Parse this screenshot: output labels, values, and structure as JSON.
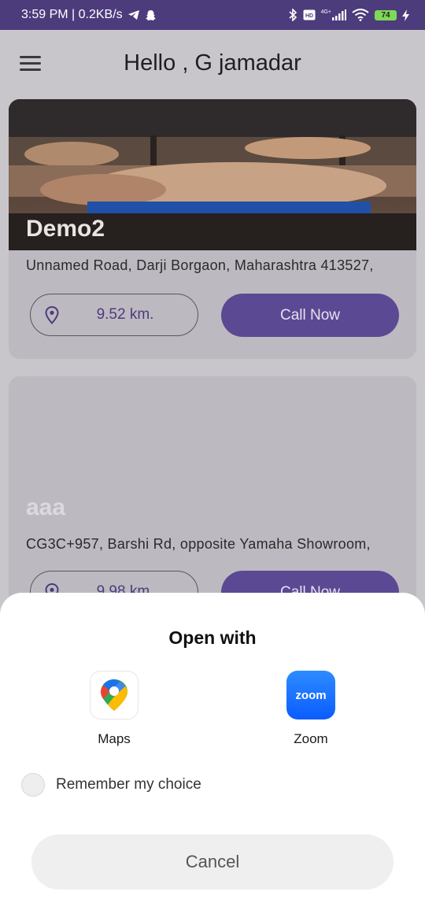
{
  "status_bar": {
    "time_speed": "3:59 PM | 0.2KB/s",
    "network": "4G+",
    "battery": "74"
  },
  "header": {
    "title": "Hello , G jamadar"
  },
  "listings": [
    {
      "name": "Demo2",
      "address": "Unnamed Road, Darji Borgaon, Maharashtra 413527,",
      "distance": "9.52 km.",
      "call_label": "Call Now"
    },
    {
      "name": "aaa",
      "address": "CG3C+957, Barshi Rd, opposite Yamaha Showroom,",
      "distance": "9.98 km.",
      "call_label": "Call Now"
    }
  ],
  "sheet": {
    "title": "Open with",
    "apps": [
      {
        "label": "Maps",
        "icon": "google-maps-icon"
      },
      {
        "label": "Zoom",
        "icon": "zoom-icon",
        "icon_text": "zoom"
      }
    ],
    "remember_label": "Remember my choice",
    "cancel_label": "Cancel"
  },
  "colors": {
    "status_bar": "#4c3c7c",
    "accent": "#5b4993",
    "battery": "#7ed957"
  }
}
